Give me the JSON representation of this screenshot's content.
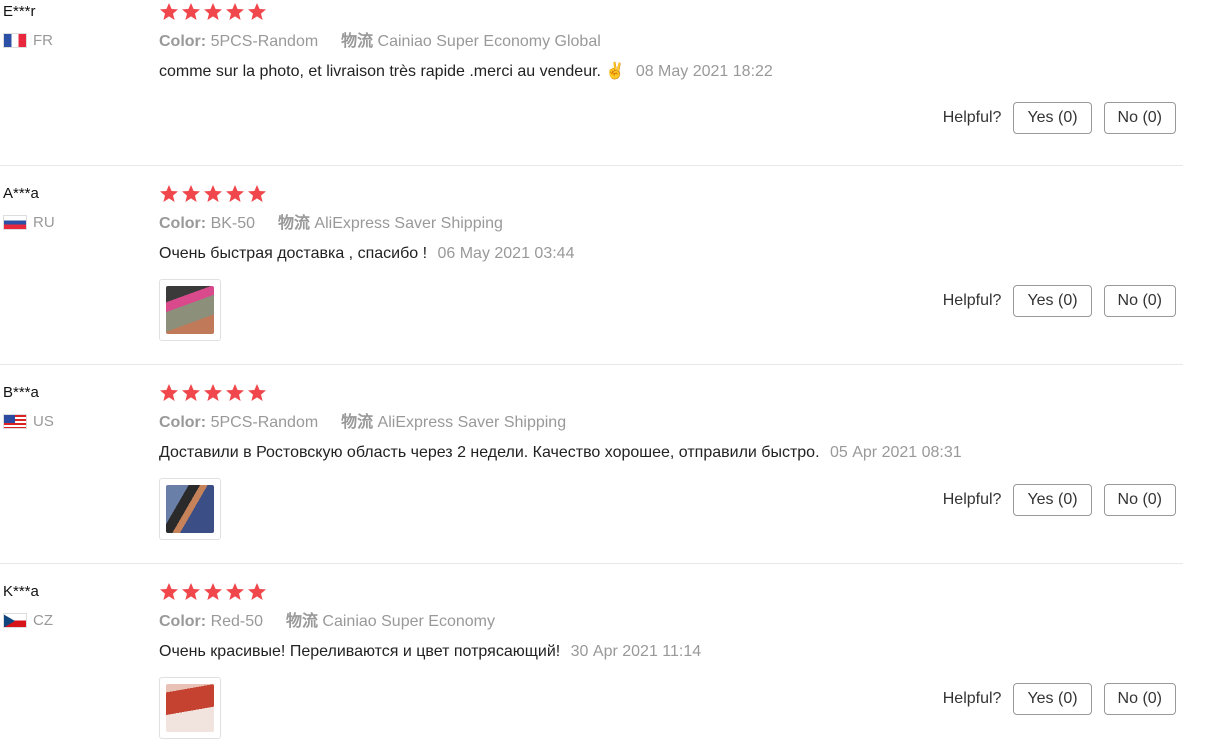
{
  "reviews": [
    {
      "user": "E***r",
      "country": "FR",
      "rating": 5,
      "color_label": "Color:",
      "color_value": "5PCS-Random",
      "shipping_label": "物流",
      "shipping_value": "Cainiao Super Economy Global",
      "text": "comme sur la photo, et livraison très rapide .merci au vendeur. ✌",
      "date": "08 May 2021 18:22",
      "helpful_label": "Helpful?",
      "yes_label": "Yes (0)",
      "no_label": "No (0)"
    },
    {
      "user": "A***a",
      "country": "RU",
      "rating": 5,
      "color_label": "Color:",
      "color_value": "BK-50",
      "shipping_label": "物流",
      "shipping_value": "AliExpress Saver Shipping",
      "text": "Очень быстрая доставка , спасибо !",
      "date": "06 May 2021 03:44",
      "helpful_label": "Helpful?",
      "yes_label": "Yes (0)",
      "no_label": "No (0)"
    },
    {
      "user": "B***a",
      "country": "US",
      "rating": 5,
      "color_label": "Color:",
      "color_value": "5PCS-Random",
      "shipping_label": "物流",
      "shipping_value": "AliExpress Saver Shipping",
      "text": "Доставили в Ростовскую область через 2 недели. Качество хорошее, отправили быстро.",
      "date": "05 Apr 2021 08:31",
      "helpful_label": "Helpful?",
      "yes_label": "Yes (0)",
      "no_label": "No (0)"
    },
    {
      "user": "K***a",
      "country": "CZ",
      "rating": 5,
      "color_label": "Color:",
      "color_value": "Red-50",
      "shipping_label": "物流",
      "shipping_value": "Cainiao Super Economy",
      "text": "Очень красивые! Переливаются и цвет потрясающий!",
      "date": "30 Apr 2021 11:14",
      "helpful_label": "Helpful?",
      "yes_label": "Yes (0)",
      "no_label": "No (0)"
    }
  ],
  "colors": {
    "star": "#f0474c",
    "muted": "#999999",
    "border": "#e8e8e8"
  }
}
